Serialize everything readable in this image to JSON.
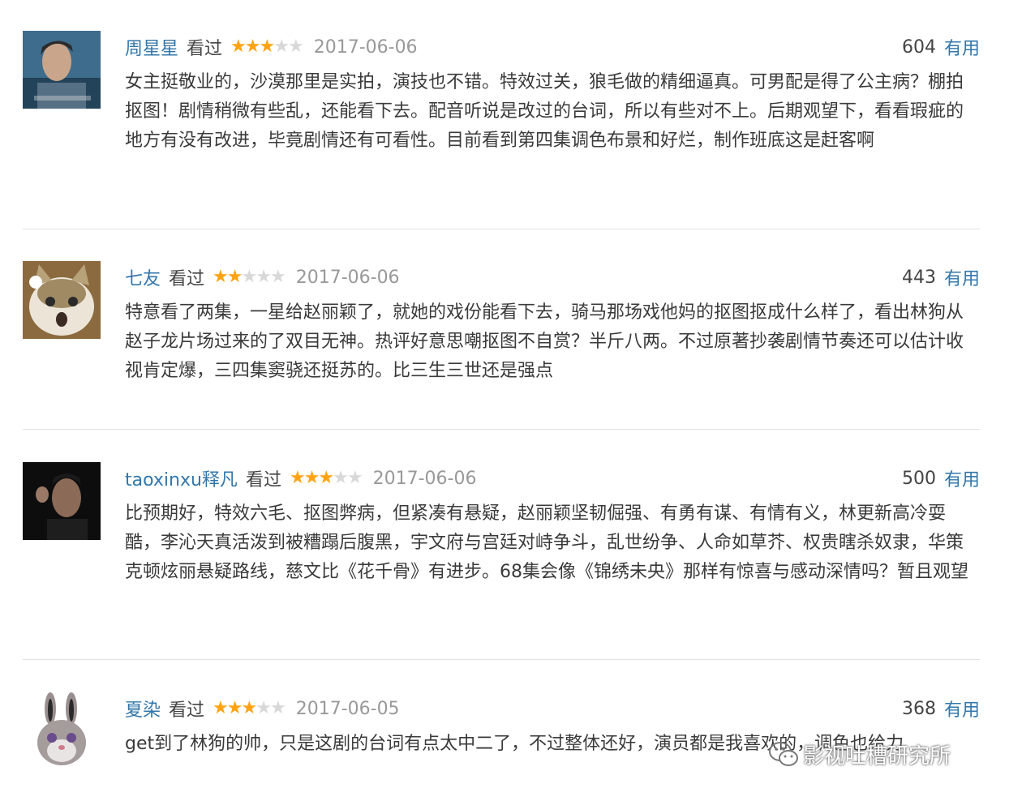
{
  "reviews": [
    {
      "user": "周星星",
      "action": "看过",
      "rating": 3,
      "date": "2017-06-06",
      "votes": "604",
      "useful_label": "有用",
      "text": "女主挺敬业的，沙漠那里是实拍，演技也不错。特效过关，狼毛做的精细逼真。可男配是得了公主病？棚拍抠图！剧情稍微有些乱，还能看下去。配音听说是改过的台词，所以有些对不上。后期观望下，看看瑕疵的地方有没有改进，毕竟剧情还有可看性。目前看到第四集调色布景和好烂，制作班底这是赶客啊"
    },
    {
      "user": "七友",
      "action": "看过",
      "rating": 2,
      "date": "2017-06-06",
      "votes": "443",
      "useful_label": "有用",
      "text": "特意看了两集，一星给赵丽颖了，就她的戏份能看下去，骑马那场戏他妈的抠图抠成什么样了，看出林狗从赵子龙片场过来的了双目无神。热评好意思嘲抠图不自赏？半斤八两。不过原著抄袭剧情节奏还可以估计收视肯定爆，三四集窦骁还挺苏的。比三生三世还是强点"
    },
    {
      "user": "taoxinxu释凡",
      "action": "看过",
      "rating": 3,
      "date": "2017-06-06",
      "votes": "500",
      "useful_label": "有用",
      "text": "比预期好，特效六毛、抠图弊病，但紧凑有悬疑，赵丽颖坚韧倔强、有勇有谋、有情有义，林更新高冷耍酷，李沁天真活泼到被糟蹋后腹黑，宇文府与宫廷对峙争斗，乱世纷争、人命如草芥、权贵瞎杀奴隶，华策克顿炫丽悬疑路线，慈文比《花千骨》有进步。68集会像《锦绣未央》那样有惊喜与感动深情吗？暂且观望"
    },
    {
      "user": "夏染",
      "action": "看过",
      "rating": 3,
      "date": "2017-06-05",
      "votes": "368",
      "useful_label": "有用",
      "text": "get到了林狗的帅，只是这剧的台词有点太中二了，不过整体还好，演员都是我喜欢的，调色也给力"
    }
  ],
  "watermark": "影视吐槽研究所",
  "colors": {
    "link": "#3377aa",
    "star_on": "#ffa312",
    "star_off": "#d8d8d8",
    "date": "#999999"
  }
}
